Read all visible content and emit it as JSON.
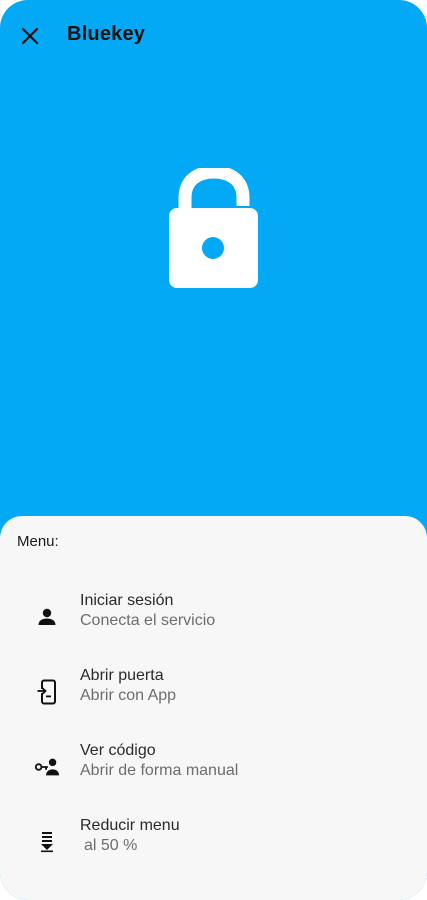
{
  "app": {
    "title": "Bluekey",
    "brand_color": "#03A9F4"
  },
  "icons": {
    "close": "close-icon",
    "lock": "lock-open-icon"
  },
  "menu": {
    "heading": "Menu:",
    "items": [
      {
        "icon": "person-icon",
        "title": "Iniciar sesión",
        "subtitle": "Conecta el servicio"
      },
      {
        "icon": "phone-door-icon",
        "title": "Abrir puerta",
        "subtitle": "Abrir con App"
      },
      {
        "icon": "key-person-icon",
        "title": "Ver código",
        "subtitle": "Abrir de forma manual"
      },
      {
        "icon": "reduce-menu-icon",
        "title": "Reducir menu",
        "subtitle": "al 50 %"
      }
    ]
  }
}
